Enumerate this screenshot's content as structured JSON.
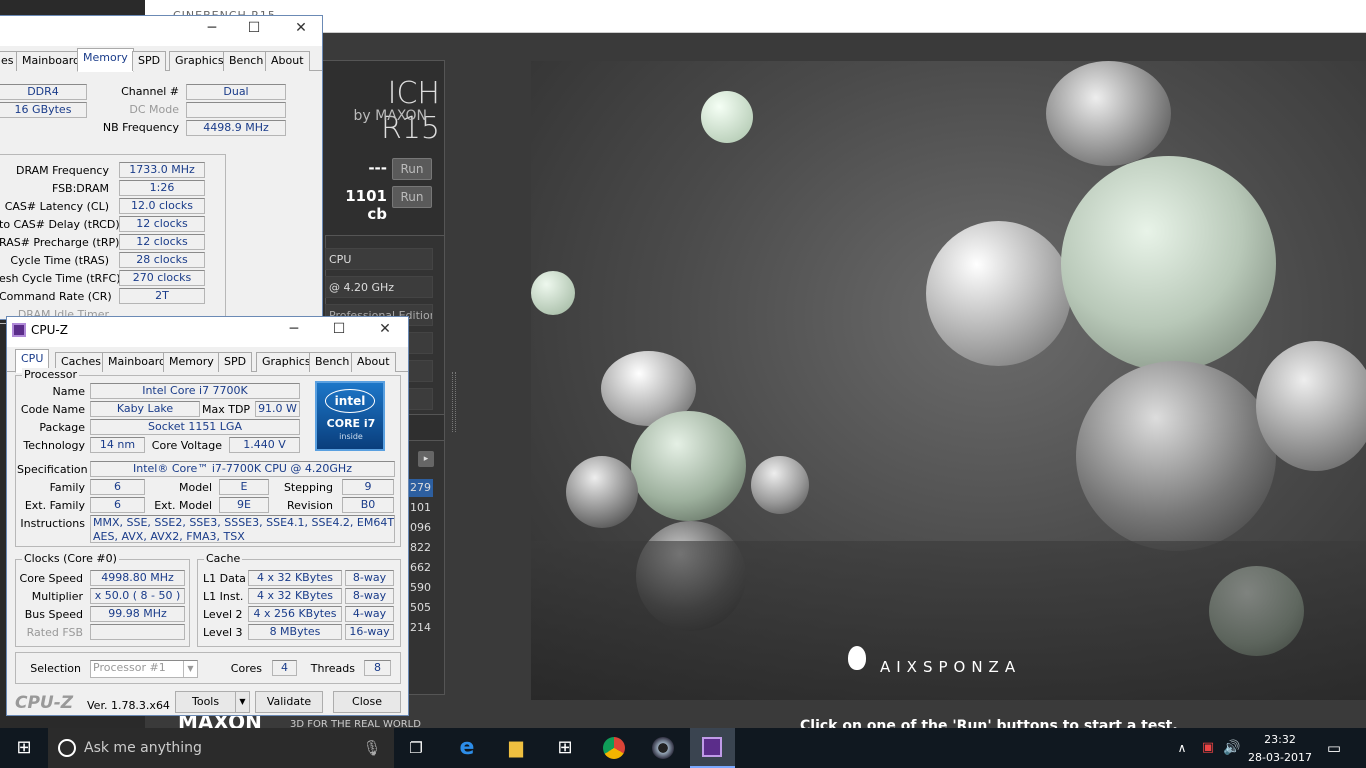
{
  "cinebench": {
    "window_title": "CINEBENCH R15",
    "logo": "ICH R15",
    "by": "by MAXON",
    "opengl_result": "---",
    "cpu_result": "1101 cb",
    "run_label": "Run",
    "info_rows": [
      "CPU",
      "@ 4.20 GHz",
      "Professional Edition",
      "",
      "",
      ""
    ],
    "ranking": [
      "279",
      "101",
      "096",
      "822",
      "662",
      "590",
      "505",
      "214"
    ],
    "hint": "Click on one of the 'Run' buttons to start a test.",
    "maxon": "MAXON",
    "maxon_tag": "3D FOR THE REAL WORLD",
    "aixsponza": "AIXSPONZA"
  },
  "memory_window": {
    "tabs": [
      "es",
      "Mainboard",
      "Memory",
      "SPD",
      "Graphics",
      "Bench",
      "About"
    ],
    "active_tab": "Memory",
    "type": "DDR4",
    "size": "16 GBytes",
    "channel_label": "Channel #",
    "channel": "Dual",
    "dc_mode_label": "DC Mode",
    "nb_freq_label": "NB Frequency",
    "nb_freq": "4498.9 MHz",
    "timings": [
      {
        "label": "DRAM Frequency",
        "value": "1733.0 MHz"
      },
      {
        "label": "FSB:DRAM",
        "value": "1:26"
      },
      {
        "label": "CAS# Latency (CL)",
        "value": "12.0 clocks"
      },
      {
        "label": "to CAS# Delay (tRCD)",
        "value": "12 clocks"
      },
      {
        "label": "RAS# Precharge (tRP)",
        "value": "12 clocks"
      },
      {
        "label": "Cycle Time (tRAS)",
        "value": "28 clocks"
      },
      {
        "label": "esh Cycle Time (tRFC)",
        "value": "270 clocks"
      },
      {
        "label": "Command Rate (CR)",
        "value": "2T"
      },
      {
        "label": "DRAM Idle Timer",
        "value": ""
      }
    ]
  },
  "cpuz": {
    "title": "CPU-Z",
    "tabs": [
      "CPU",
      "Caches",
      "Mainboard",
      "Memory",
      "SPD",
      "Graphics",
      "Bench",
      "About"
    ],
    "processor_group": "Processor",
    "name_label": "Name",
    "name": "Intel Core i7 7700K",
    "codename_label": "Code Name",
    "codename": "Kaby Lake",
    "tdp_label": "Max TDP",
    "tdp": "91.0 W",
    "package_label": "Package",
    "package": "Socket 1151 LGA",
    "tech_label": "Technology",
    "tech": "14 nm",
    "voltage_label": "Core Voltage",
    "voltage": "1.440 V",
    "spec_label": "Specification",
    "spec": "Intel® Core™ i7-7700K CPU @ 4.20GHz",
    "family_label": "Family",
    "family": "6",
    "model_label": "Model",
    "model": "E",
    "stepping_label": "Stepping",
    "stepping": "9",
    "extfamily_label": "Ext. Family",
    "extfamily": "6",
    "extmodel_label": "Ext. Model",
    "extmodel": "9E",
    "revision_label": "Revision",
    "revision": "B0",
    "instructions_label": "Instructions",
    "instructions_1": "MMX, SSE, SSE2, SSE3, SSSE3, SSE4.1, SSE4.2, EM64T, VT-x,",
    "instructions_2": "AES, AVX, AVX2, FMA3, TSX",
    "intel_badge": {
      "brand": "intel",
      "line1": "CORE i7",
      "line2": "inside"
    },
    "clocks_group": "Clocks (Core #0)",
    "core_speed_label": "Core Speed",
    "core_speed": "4998.80 MHz",
    "multiplier_label": "Multiplier",
    "multiplier": "x 50.0 ( 8 - 50 )",
    "bus_speed_label": "Bus Speed",
    "bus_speed": "99.98 MHz",
    "rated_fsb_label": "Rated FSB",
    "cache_group": "Cache",
    "cache": [
      {
        "label": "L1 Data",
        "size": "4 x 32 KBytes",
        "way": "8-way"
      },
      {
        "label": "L1 Inst.",
        "size": "4 x 32 KBytes",
        "way": "8-way"
      },
      {
        "label": "Level 2",
        "size": "4 x 256 KBytes",
        "way": "4-way"
      },
      {
        "label": "Level 3",
        "size": "8 MBytes",
        "way": "16-way"
      }
    ],
    "selection_label": "Selection",
    "selection": "Processor #1",
    "cores_label": "Cores",
    "cores": "4",
    "threads_label": "Threads",
    "threads": "8",
    "brand": "CPU-Z",
    "version": "Ver. 1.78.3.x64",
    "tools_label": "Tools",
    "validate_label": "Validate",
    "close_label": "Close"
  },
  "taskbar": {
    "search_placeholder": "Ask me anything",
    "time": "23:32",
    "date": "28-03-2017"
  }
}
